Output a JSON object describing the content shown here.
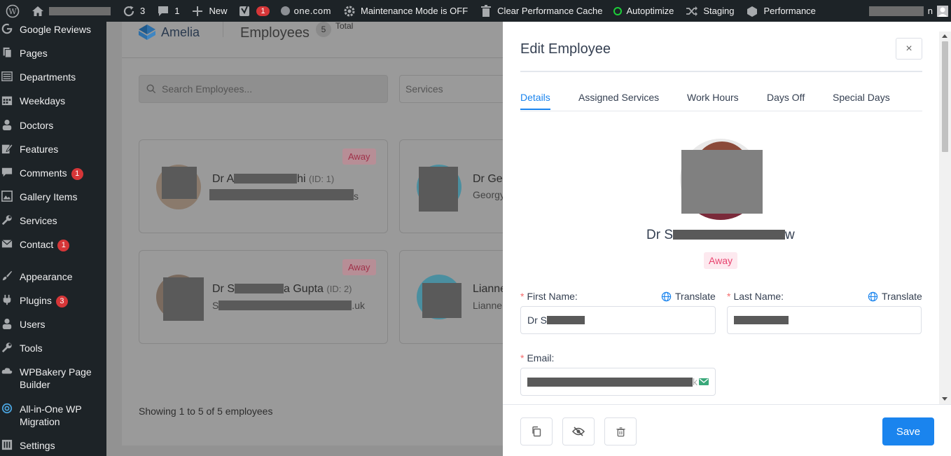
{
  "adminbar": {
    "updates_count": "3",
    "comments_count": "1",
    "new_label": "New",
    "yoast_badge": "1",
    "onecom_label": "one.com",
    "maintenance_label": "Maintenance Mode is OFF",
    "clear_cache_label": "Clear Performance Cache",
    "autoptimize_label": "Autoptimize",
    "staging_label": "Staging",
    "performance_label": "Performance",
    "user_suffix": "n"
  },
  "sidebar": {
    "items": [
      {
        "label": "Google Reviews",
        "icon": "google-icon"
      },
      {
        "label": "Pages",
        "icon": "pages-icon"
      },
      {
        "label": "Departments",
        "icon": "list-icon"
      },
      {
        "label": "Weekdays",
        "icon": "calendar-icon"
      },
      {
        "label": "Doctors",
        "icon": "user-icon"
      },
      {
        "label": "Features",
        "icon": "edit-icon"
      },
      {
        "label": "Comments",
        "icon": "comment-icon",
        "badge": "1"
      },
      {
        "label": "Gallery Items",
        "icon": "gallery-icon"
      },
      {
        "label": "Services",
        "icon": "wrench-icon"
      },
      {
        "label": "Contact",
        "icon": "mail-icon",
        "badge": "1"
      },
      {
        "label": "Appearance",
        "icon": "brush-icon"
      },
      {
        "label": "Plugins",
        "icon": "plugin-icon",
        "badge": "3"
      },
      {
        "label": "Users",
        "icon": "users-icon"
      },
      {
        "label": "Tools",
        "icon": "tools-icon"
      },
      {
        "label": "WPBakery Page Builder",
        "icon": "cloud-icon"
      },
      {
        "label": "All-in-One WP Migration",
        "icon": "migration-icon"
      },
      {
        "label": "Settings",
        "icon": "settings-icon"
      }
    ]
  },
  "amelia": {
    "brand": "Amelia",
    "page_title": "Employees",
    "count": "5",
    "total_label": "Total",
    "search_placeholder": "Search Employees...",
    "services_placeholder": "Services",
    "showing_text": "Showing 1 to 5 of 5 employees",
    "cards": [
      {
        "name_prefix": "Dr A",
        "name_suffix": "hi",
        "id_text": "(ID: 1)",
        "sub_tail": "s",
        "status": "Away"
      },
      {
        "name_prefix": "Dr Ge",
        "sub": "Georgy"
      },
      {
        "name_prefix": "Dr S",
        "name_mid": "a Gupta",
        "id_text": "(ID: 2)",
        "sub_prefix": "S",
        "sub_tail": ".uk",
        "status": "Away"
      },
      {
        "name_prefix": "Lianne",
        "sub": "Lianne"
      }
    ]
  },
  "drawer": {
    "title": "Edit Employee",
    "close_label": "×",
    "tabs": [
      "Details",
      "Assigned Services",
      "Work Hours",
      "Days Off",
      "Special Days"
    ],
    "active_tab": "Details",
    "profile_name_prefix": "Dr S",
    "profile_name_suffix": "w",
    "status": "Away",
    "first_name_label": "First Name:",
    "last_name_label": "Last Name:",
    "email_label": "Email:",
    "translate_label": "Translate",
    "first_name_value": "Dr S",
    "email_tail": "k",
    "save_label": "Save"
  },
  "colors": {
    "primary": "#1a84ee",
    "danger_badge": "#d63638",
    "away": "#e8446f",
    "admin_bg": "#1d2327"
  }
}
